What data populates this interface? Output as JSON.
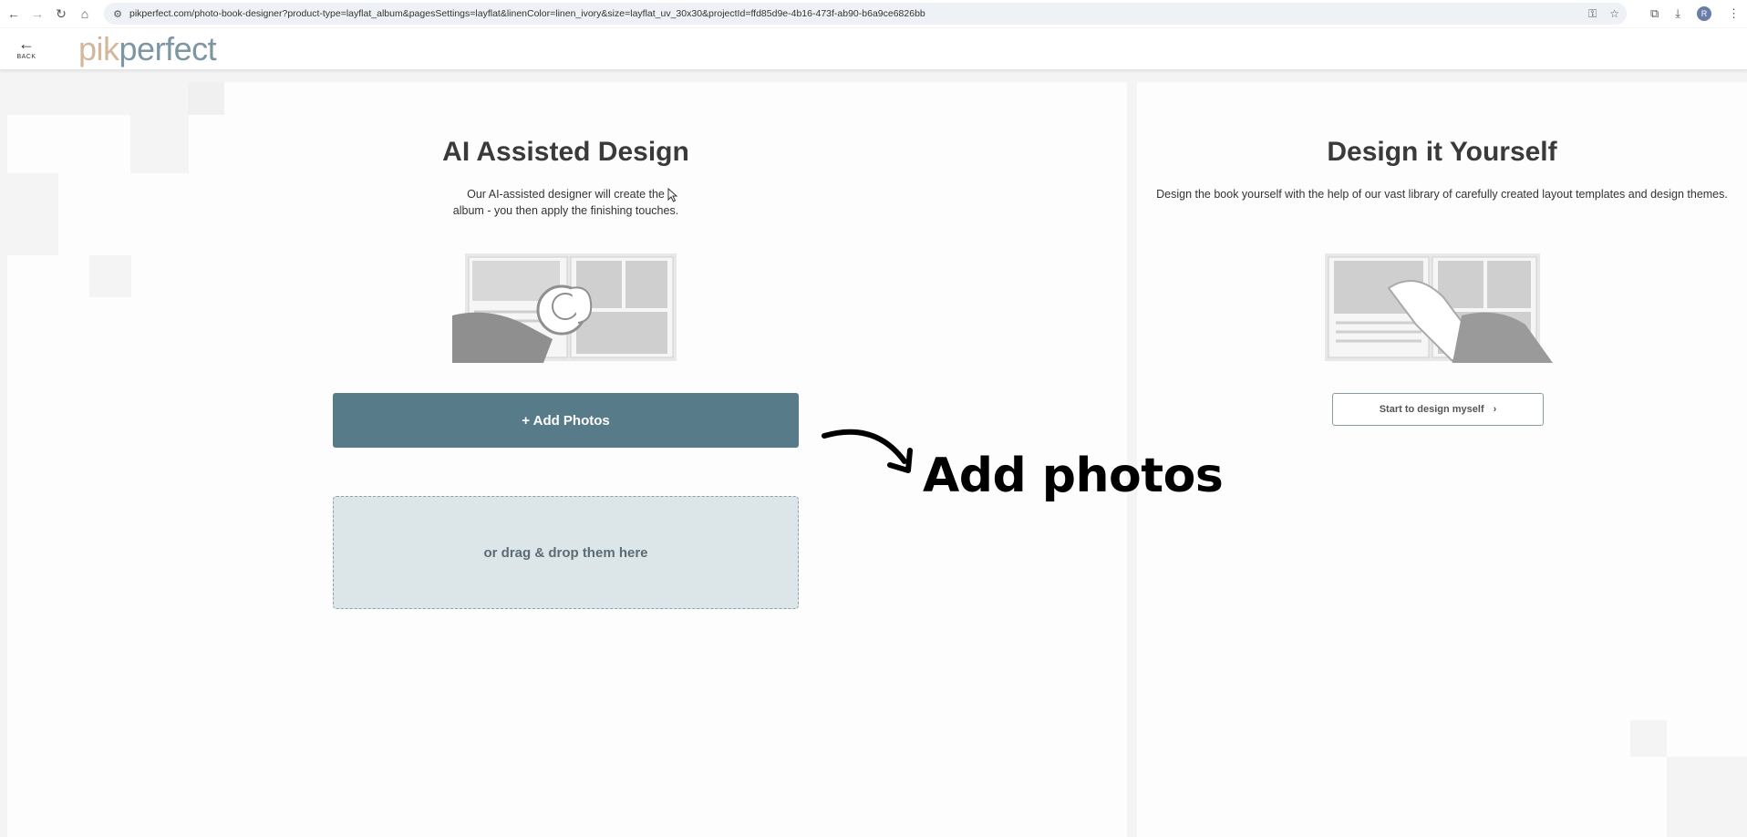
{
  "browser": {
    "url": "pikperfect.com/photo-book-designer?product-type=layflat_album&pagesSettings=layflat&linenColor=linen_ivory&size=layflat_uv_30x30&projectId=ffd85d9e-4b16-473f-ab90-b6a9ce6826bb",
    "avatar_letter": "R"
  },
  "header": {
    "back_label": "BACK",
    "logo_part1": "pik",
    "logo_part2": "perfect"
  },
  "ai_section": {
    "title": "AI Assisted Design",
    "desc_line1": "Our AI-assisted designer will create the",
    "desc_line2": "album - you then apply the finishing touches.",
    "add_photos_label": "+ Add Photos",
    "drop_label": "or drag & drop them here"
  },
  "diy_section": {
    "title": "Design it Yourself",
    "desc": "Design the book yourself with the help of our vast library of carefully created layout templates and design themes.",
    "button_label": "Start to design myself"
  },
  "annotation": {
    "text": "Add photos"
  },
  "colors": {
    "accent": "#587b8a",
    "drop_bg": "#dce5e8"
  }
}
